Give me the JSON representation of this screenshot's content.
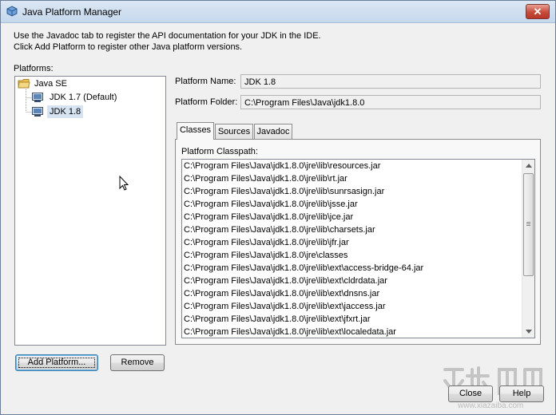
{
  "window": {
    "title": "Java Platform Manager",
    "close_glyph": "✕"
  },
  "instructions": {
    "line1": "Use the Javadoc tab to register the API documentation for your JDK in the IDE.",
    "line2": "Click Add Platform to register other Java platform versions."
  },
  "platforms": {
    "label": "Platforms:",
    "root": {
      "label": "Java SE",
      "icon": "folder-icon"
    },
    "items": [
      {
        "label": "JDK 1.7 (Default)",
        "icon": "platform-icon",
        "selected": false
      },
      {
        "label": "JDK 1.8",
        "icon": "platform-icon",
        "selected": true
      }
    ]
  },
  "details": {
    "name_label": "Platform Name:",
    "name_value": "JDK 1.8",
    "folder_label": "Platform Folder:",
    "folder_value": "C:\\Program Files\\Java\\jdk1.8.0"
  },
  "tabs": [
    {
      "label": "Classes",
      "active": true
    },
    {
      "label": "Sources",
      "active": false
    },
    {
      "label": "Javadoc",
      "active": false
    }
  ],
  "classpath": {
    "label": "Platform Classpath:",
    "entries": [
      "C:\\Program Files\\Java\\jdk1.8.0\\jre\\lib\\resources.jar",
      "C:\\Program Files\\Java\\jdk1.8.0\\jre\\lib\\rt.jar",
      "C:\\Program Files\\Java\\jdk1.8.0\\jre\\lib\\sunrsasign.jar",
      "C:\\Program Files\\Java\\jdk1.8.0\\jre\\lib\\jsse.jar",
      "C:\\Program Files\\Java\\jdk1.8.0\\jre\\lib\\jce.jar",
      "C:\\Program Files\\Java\\jdk1.8.0\\jre\\lib\\charsets.jar",
      "C:\\Program Files\\Java\\jdk1.8.0\\jre\\lib\\jfr.jar",
      "C:\\Program Files\\Java\\jdk1.8.0\\jre\\classes",
      "C:\\Program Files\\Java\\jdk1.8.0\\jre\\lib\\ext\\access-bridge-64.jar",
      "C:\\Program Files\\Java\\jdk1.8.0\\jre\\lib\\ext\\cldrdata.jar",
      "C:\\Program Files\\Java\\jdk1.8.0\\jre\\lib\\ext\\dnsns.jar",
      "C:\\Program Files\\Java\\jdk1.8.0\\jre\\lib\\ext\\jaccess.jar",
      "C:\\Program Files\\Java\\jdk1.8.0\\jre\\lib\\ext\\jfxrt.jar",
      "C:\\Program Files\\Java\\jdk1.8.0\\jre\\lib\\ext\\localedata.jar"
    ]
  },
  "buttons": {
    "add_platform": "Add Platform...",
    "remove": "Remove",
    "close": "Close",
    "help": "Help"
  },
  "watermark": {
    "text": "www.xiazaiba.com"
  },
  "colors": {
    "titlebar": "#c5d8ec",
    "close_button": "#c74a3b",
    "selection": "#d5e3f3",
    "default_button_border": "#3c7fb1",
    "folder": "#e8c15a"
  }
}
